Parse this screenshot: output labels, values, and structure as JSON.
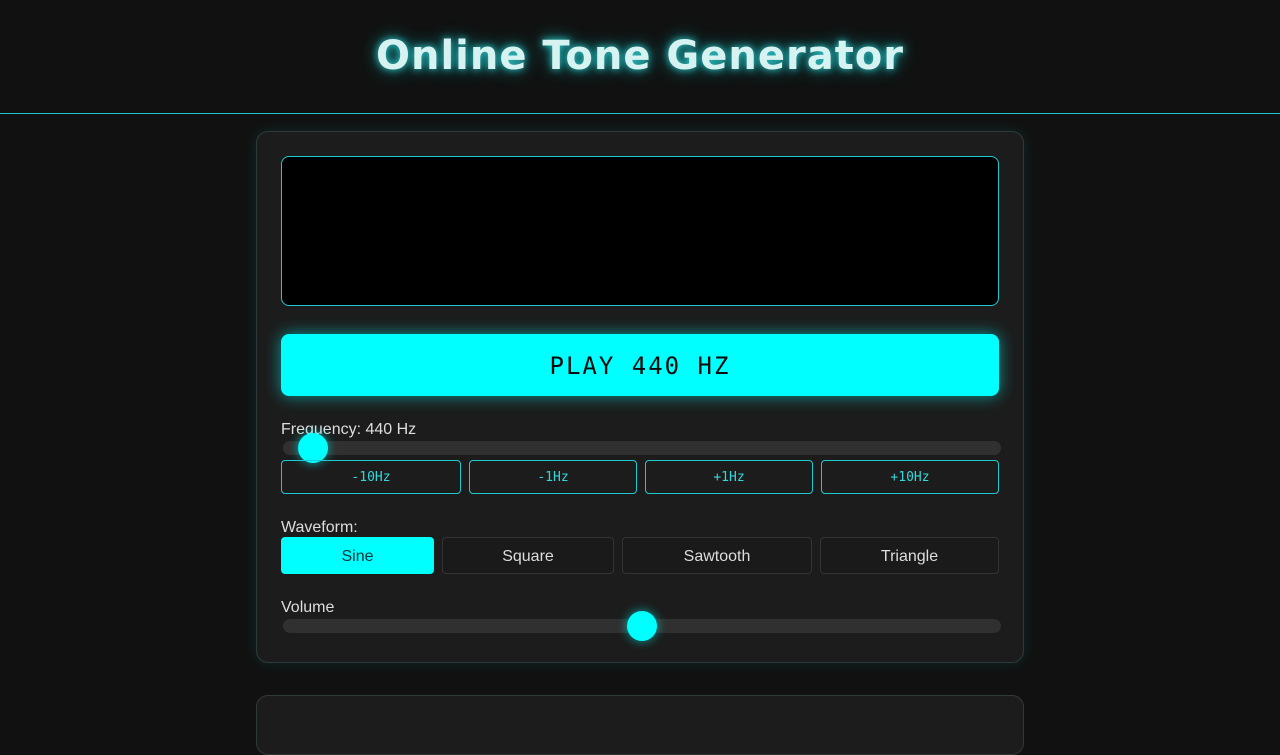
{
  "header": {
    "title": "Online Tone Generator"
  },
  "player": {
    "play_label": "PLAY 440 HZ"
  },
  "frequency": {
    "label": "Frequency: 440 Hz",
    "value_hz": 440,
    "slider_fraction": 0.0223,
    "steps": [
      "-10Hz",
      "-1Hz",
      "+1Hz",
      "+10Hz"
    ]
  },
  "waveform": {
    "label": "Waveform:",
    "options": [
      "Sine",
      "Square",
      "Sawtooth",
      "Triangle"
    ],
    "selected": "Sine"
  },
  "volume": {
    "label": "Volume",
    "level": 0.5
  },
  "colors": {
    "accent": "#00ffff",
    "background": "#111111",
    "panel": "#1c1c1c"
  }
}
